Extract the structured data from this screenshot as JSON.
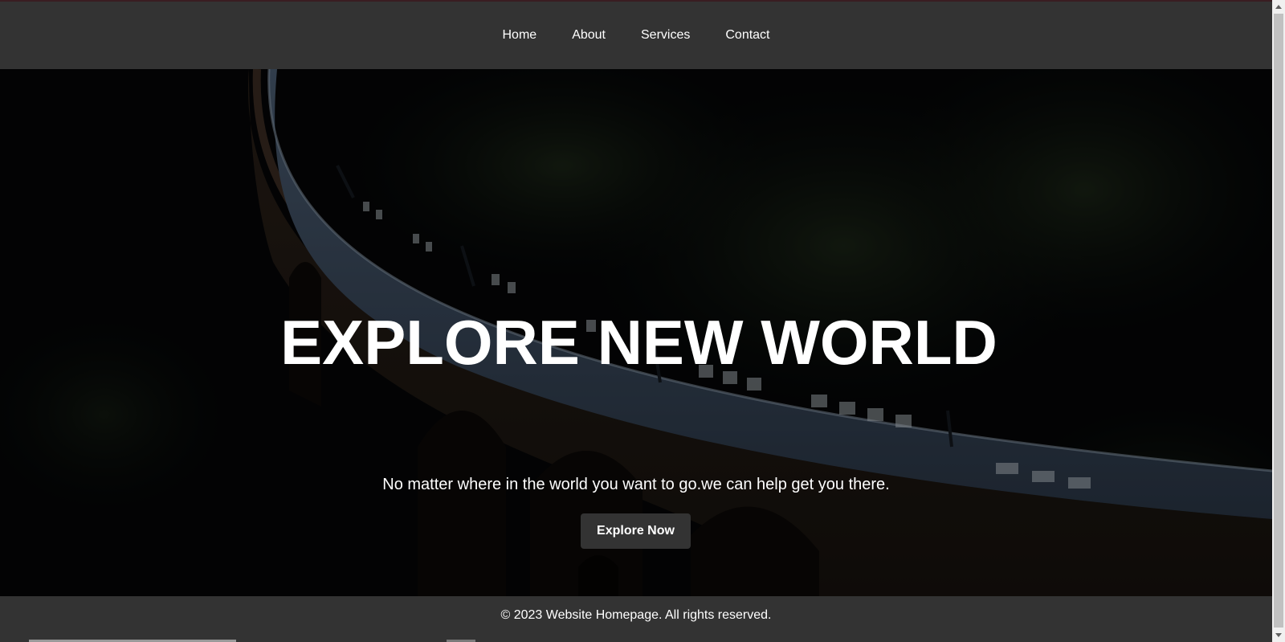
{
  "nav": {
    "items": [
      {
        "label": "Home"
      },
      {
        "label": "About"
      },
      {
        "label": "Services"
      },
      {
        "label": "Contact"
      }
    ]
  },
  "hero": {
    "title": "EXPLORE NEW WORLD",
    "subtitle": "No matter where in the world you want to go.we can help get you there.",
    "button_label": "Explore Now",
    "background_image": "train-on-bridge-through-forest"
  },
  "footer": {
    "text": "© 2023 Website Homepage. All rights reserved."
  },
  "colors": {
    "nav_background": "#333333",
    "footer_background": "#333333",
    "button_background": "#333333",
    "text": "#ffffff"
  }
}
